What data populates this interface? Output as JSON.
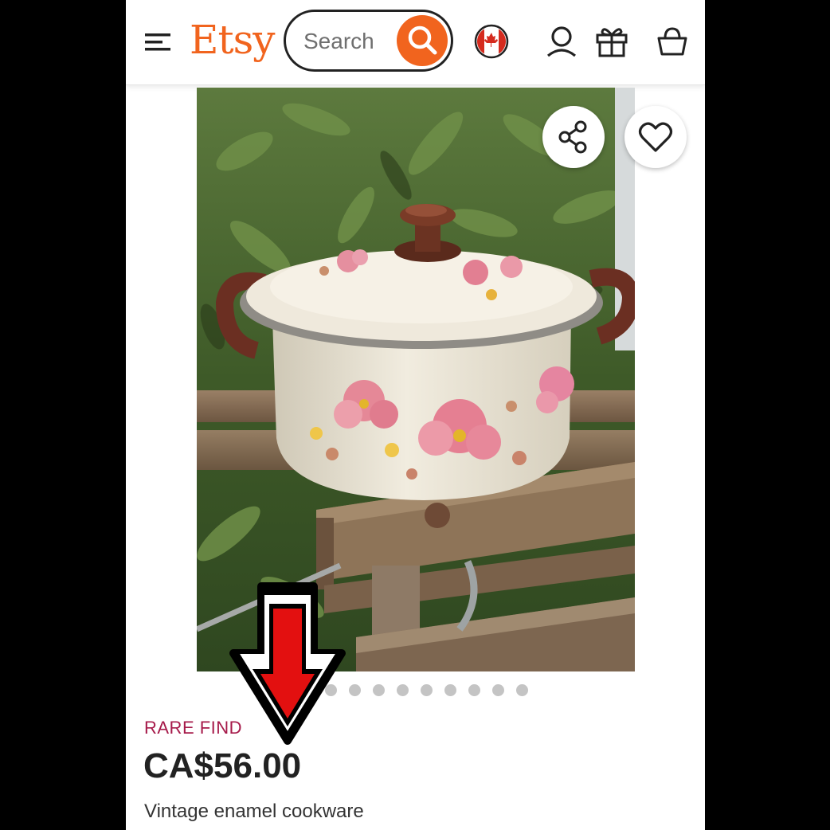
{
  "header": {
    "logo": "Etsy",
    "search_placeholder": "Search"
  },
  "listing": {
    "badge": "RARE FIND",
    "price": "CA$56.00",
    "title": "Vintage enamel cookware",
    "image_dot_count": 9
  },
  "colors": {
    "brand": "#f1641e",
    "badge": "#a61a4a",
    "text": "#222222"
  },
  "icons": [
    "menu-icon",
    "search-icon",
    "canada-flag-icon",
    "account-icon",
    "gift-icon",
    "cart-icon",
    "share-icon",
    "heart-icon",
    "red-arrow-overlay"
  ]
}
